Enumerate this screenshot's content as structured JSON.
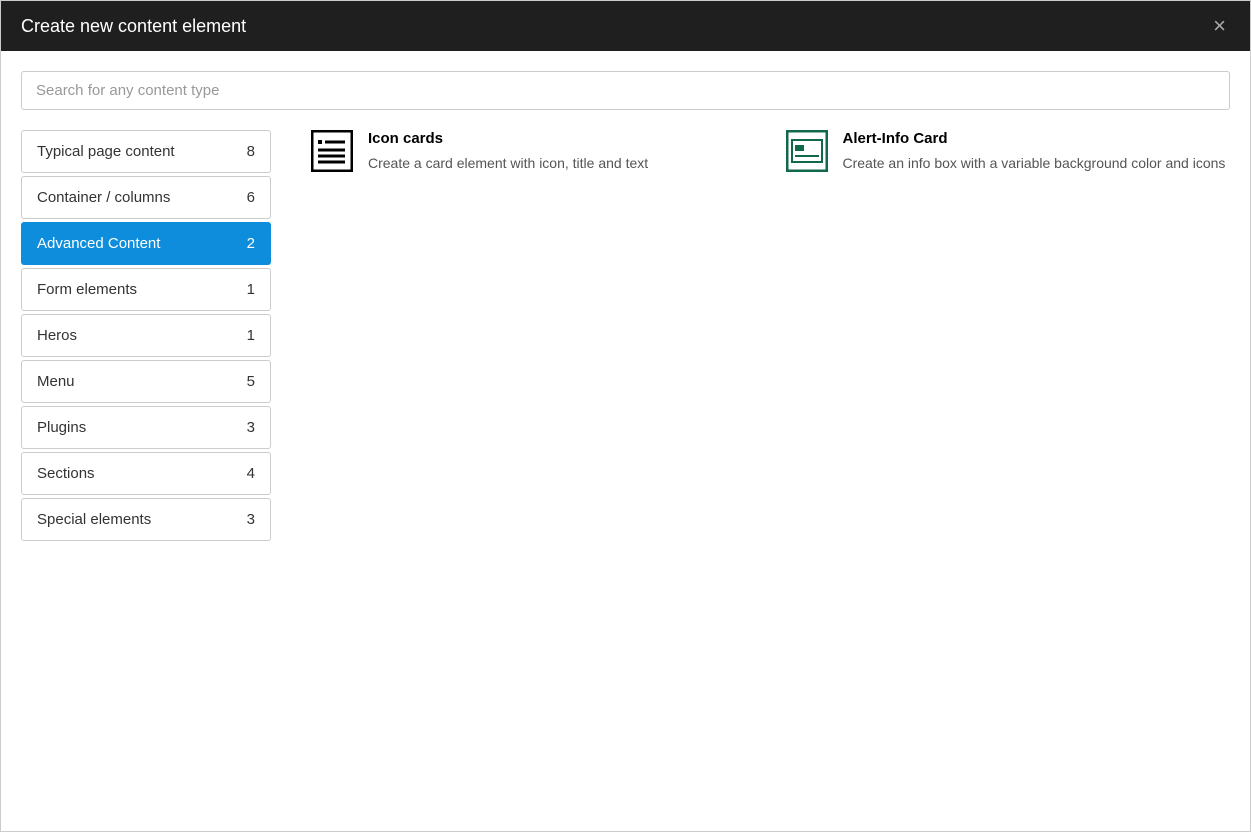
{
  "modal": {
    "title": "Create new content element"
  },
  "search": {
    "placeholder": "Search for any content type",
    "value": ""
  },
  "tabs": [
    {
      "label": "Typical page content",
      "count": "8",
      "active": false
    },
    {
      "label": "Container / columns",
      "count": "6",
      "active": false
    },
    {
      "label": "Advanced Content",
      "count": "2",
      "active": true
    },
    {
      "label": "Form elements",
      "count": "1",
      "active": false
    },
    {
      "label": "Heros",
      "count": "1",
      "active": false
    },
    {
      "label": "Menu",
      "count": "5",
      "active": false
    },
    {
      "label": "Plugins",
      "count": "3",
      "active": false
    },
    {
      "label": "Sections",
      "count": "4",
      "active": false
    },
    {
      "label": "Special elements",
      "count": "3",
      "active": false
    }
  ],
  "elements": [
    {
      "title": "Icon cards",
      "description": "Create a card element with icon, title and text",
      "icon": "icon-cards-icon"
    },
    {
      "title": "Alert-Info Card",
      "description": "Create an info box with a variable background color and icons",
      "icon": "alert-info-icon"
    }
  ]
}
